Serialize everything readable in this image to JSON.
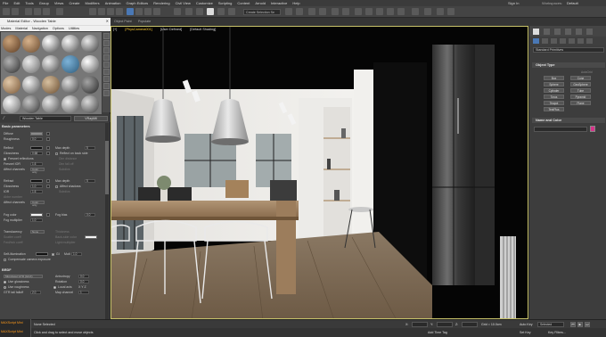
{
  "menubar": {
    "items": [
      "File",
      "Edit",
      "Tools",
      "Group",
      "Views",
      "Create",
      "Modifiers",
      "Animation",
      "Graph Editors",
      "Rendering",
      "Civil View",
      "Customize",
      "Scripting",
      "Content",
      "Arnold",
      "Interactive",
      "Help"
    ],
    "sign_in": "Sign In",
    "workspaces_label": "Workspaces:",
    "workspaces_value": "Default"
  },
  "toolbar": {
    "selection_set_placeholder": "Create Selection Se"
  },
  "material_editor": {
    "title": "Material Editor - Wooden Table",
    "close": "✕",
    "menu": [
      "Modes",
      "Material",
      "Navigation",
      "Options",
      "Utilities"
    ],
    "material_name": "Wooden Table",
    "material_type": "VRayMtl",
    "basic_parameters_title": "Basic parameters",
    "diffuse": "Diffuse",
    "roughness": "Roughness",
    "roughness_val": "0.0",
    "reflect": "Reflect",
    "max_depth": "Max depth",
    "max_depth_val": "5",
    "glossiness": "Glossiness",
    "glossiness_val": "0.68",
    "reflect_on_back": "Reflect on back side",
    "fresnel_reflections": "Fresnel reflections",
    "dim_reflect": "Dim distance",
    "fresnel_ior": "Fresnel IOR",
    "fresnel_ior_val": "1.6",
    "dim_falloff": "Dim fall off",
    "affect_channels": "Affect channels",
    "affect_channels_val": "Color only",
    "subdivs": "Subdivs",
    "refract": "Refract",
    "refract_max_depth": "Max depth",
    "refract_max_depth_val": "5",
    "refract_glossiness": "Glossiness",
    "refract_glossiness_val": "1.0",
    "affect_shadows": "Affect shadows",
    "ior": "IOR",
    "ior_val": "1.6",
    "abbe_number": "Abbe number",
    "affect_channels_2": "Affect channels",
    "affect_channels_2_val": "Color only",
    "fog_color": "Fog color",
    "fog_bias": "Fog bias",
    "fog_bias_val": "0.0",
    "fog_multiplier": "Fog multiplier",
    "fog_multiplier_val": "1.0",
    "translucency": "Translucency",
    "translucency_val": "None",
    "thickness": "Thickness",
    "scatter_coeff": "Scatter coeff",
    "back_side_color": "Back-side color",
    "fwd_bck_coeff": "Fwd/bck coeff",
    "light_multiplier": "Light multiplier",
    "self_illumination": "Self-illumination",
    "gi": "GI",
    "mult": "Mult",
    "mult_val": "1.0",
    "compensate_exposure": "Compensate camera exposure",
    "brdf_title": "BRDF",
    "brdf_type": "Microfacet GTR (GGX)",
    "anisotropy": "Anisotropy",
    "anisotropy_val": "0.0",
    "use_glossiness": "Use glossiness",
    "rotation": "Rotation",
    "rotation_val": "0.0",
    "use_roughness": "Use roughness",
    "local_axis": "Local axis",
    "local_axis_val": "X Y Z",
    "gtr_tail": "GTR tail falloff",
    "gtr_tail_val": "2.0",
    "map_channel": "Map channel",
    "map_channel_val": "1"
  },
  "viewport": {
    "label_parts": [
      "[+]",
      "[PhysCamera001]",
      "[User Defined]",
      "[Default Shading]"
    ]
  },
  "command_panel": {
    "dropdown": "Standard Primitives",
    "object_type_title": "Object Type",
    "autogrid": "AutoGrid",
    "object_types": [
      "Box",
      "Cone",
      "Sphere",
      "GeoSphere",
      "Cylinder",
      "Tube",
      "Torus",
      "Pyramid",
      "Teapot",
      "Plane",
      "TextPlus"
    ],
    "name_color_title": "Name and Color"
  },
  "status": {
    "maxscript_1": "MAXScript Mini",
    "maxscript_2": "MAXScript Mini",
    "none_selected": "None Selected",
    "prompt": "Click and drag to select and move objects",
    "x_label": "X:",
    "y_label": "Y:",
    "z_label": "Z:",
    "grid": "Grid = 10.0cm",
    "add_time_tag": "Add Time Tag",
    "auto_key": "Auto Key",
    "set_key": "Set Key",
    "selected": "Selected",
    "key_filters": "Key Filters..."
  },
  "colors": {
    "accent": "#4a78b5",
    "viewport_border": "#c8c26a",
    "name_color_swatch": "#d6338a",
    "maxscript_text": "#ff9a1a"
  }
}
